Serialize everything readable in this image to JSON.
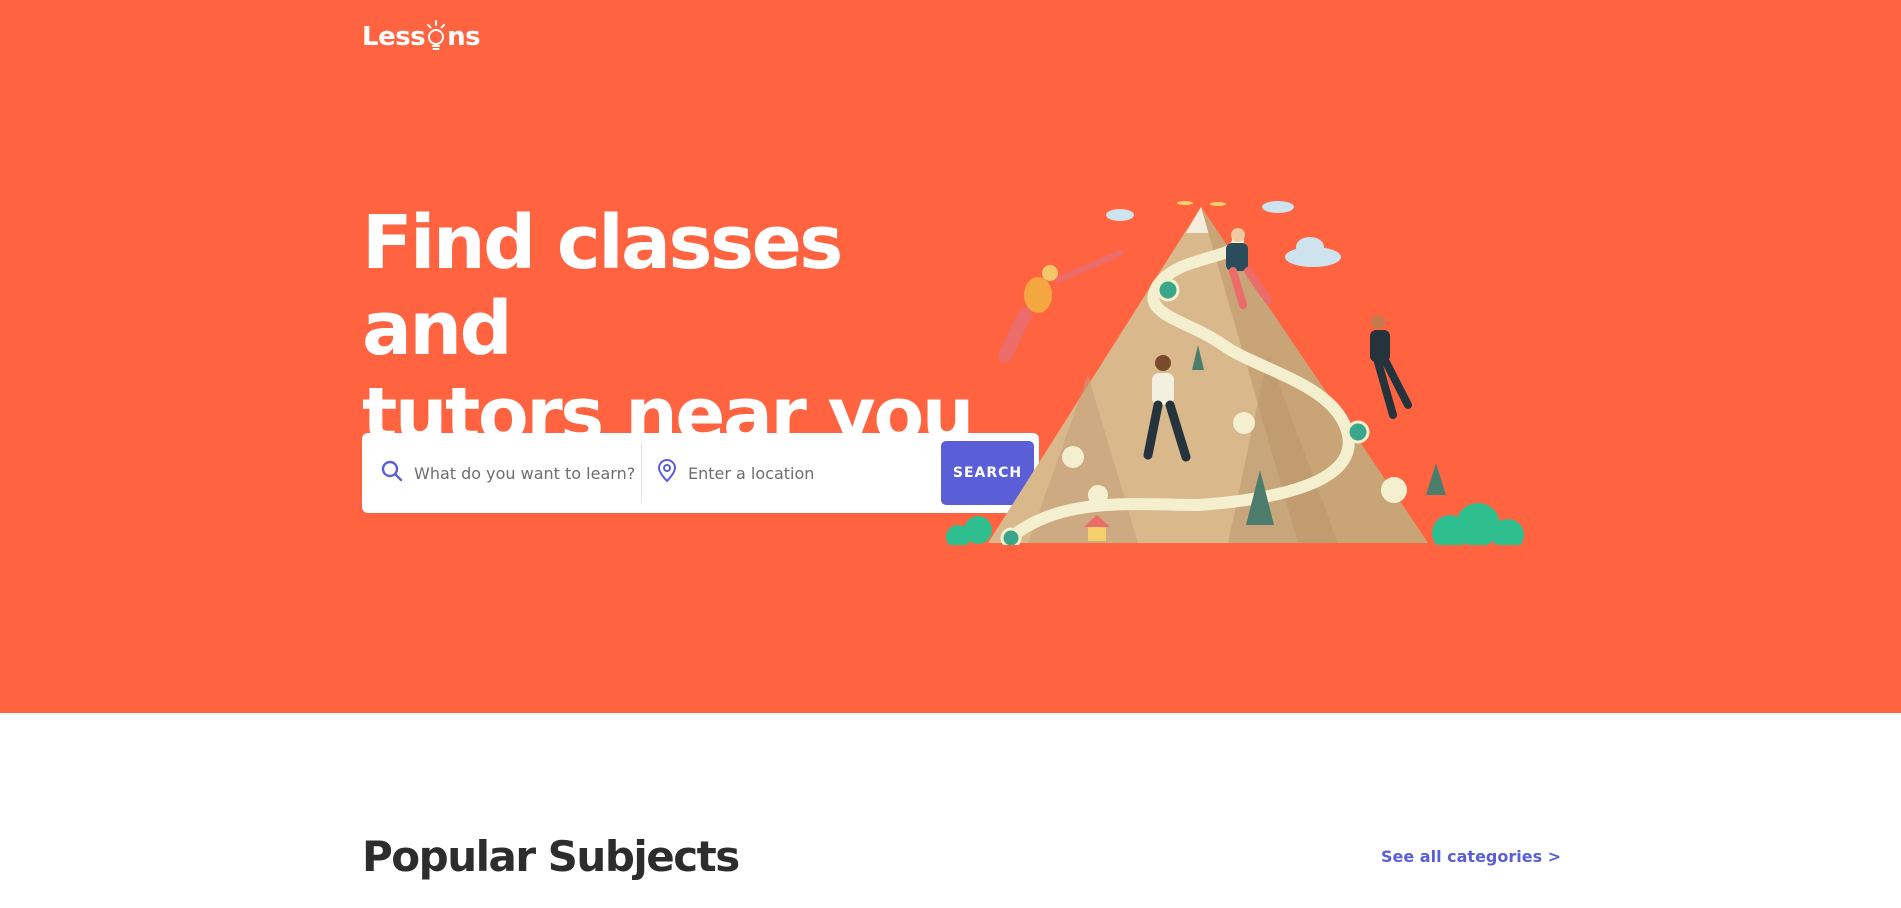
{
  "brand": {
    "prefix": "Less",
    "suffix": "ns",
    "logo_alt": "Lessons"
  },
  "hero": {
    "headline_line1": "Find classes and",
    "headline_line2": "tutors near you",
    "bg_color": "#ff6340"
  },
  "search": {
    "learn_placeholder": "What do you want to learn?",
    "location_placeholder": "Enter a location",
    "button_label": "SEARCH",
    "learn_icon": "search-icon",
    "location_icon": "map-pin-icon",
    "accent_color": "#5a5fd8"
  },
  "popular": {
    "title": "Popular Subjects",
    "see_all_label": "See all categories >"
  }
}
